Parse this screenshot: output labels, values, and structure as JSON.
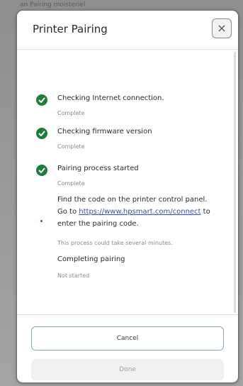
{
  "background": {
    "partial_text": "an Pairing moisteriel"
  },
  "dialog": {
    "title": "Printer Pairing",
    "close_label": "×"
  },
  "steps": [
    {
      "title": "Checking Internet connection.",
      "status": "Complete",
      "icon": "check-icon"
    },
    {
      "title": "Checking firmware version",
      "status": "Complete",
      "icon": "check-icon"
    },
    {
      "title": "Pairing process started",
      "status": "Complete",
      "icon": "check-icon"
    }
  ],
  "pairing_instruction": {
    "line1": "Find the code on the printer control panel.",
    "go_to": "Go to ",
    "link": "https://www.hpsmart.com/connect",
    "line2_suffix": " to",
    "line3": "enter the pairing code.",
    "note": "This process could take several minutes.",
    "icon": "progress-dot-icon"
  },
  "completing": {
    "title": "Completing pairing",
    "status": "Not started"
  },
  "footer": {
    "cancel_label": "Cancel",
    "done_label": "Done"
  },
  "colors": {
    "success": "#1e7d3a",
    "link": "#3b4fb0",
    "accent_border": "#8aa6ba"
  }
}
